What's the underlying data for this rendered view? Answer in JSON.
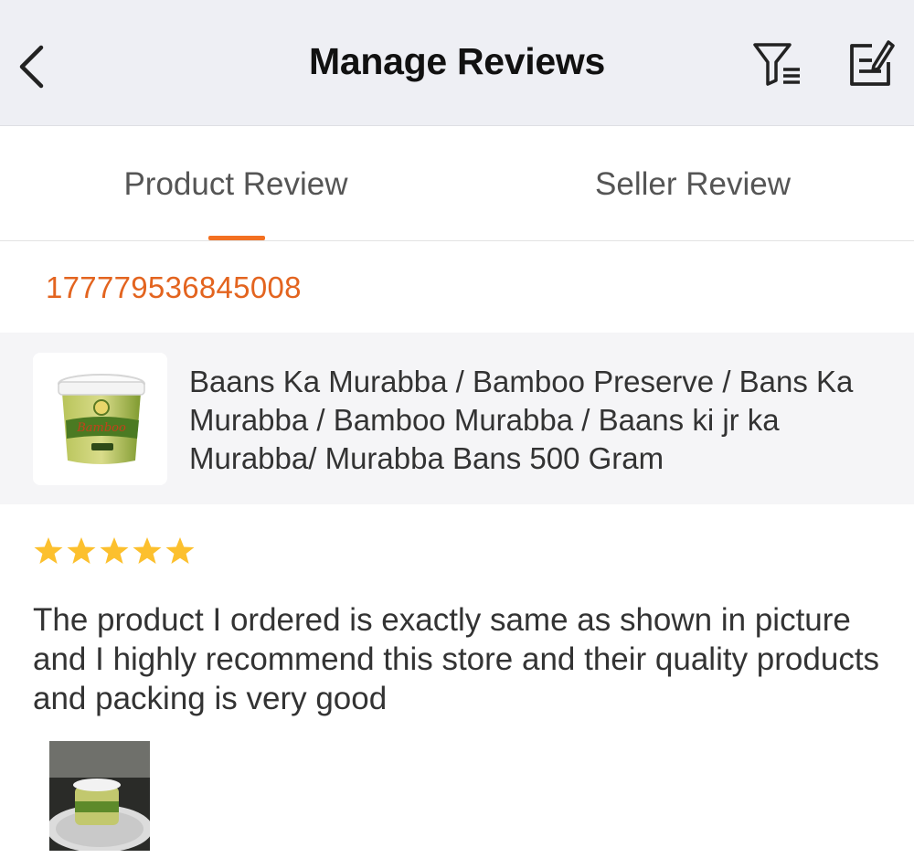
{
  "header": {
    "title": "Manage Reviews",
    "back_icon": "chevron-left-icon",
    "filter_icon": "filter-list-icon",
    "edit_icon": "write-review-icon"
  },
  "tabs": [
    {
      "label": "Product Review",
      "active": true
    },
    {
      "label": "Seller Review",
      "active": false
    }
  ],
  "order": {
    "id": "177779536845008"
  },
  "product": {
    "title": "Baans Ka Murabba / Bamboo Preserve / Bans Ka Murabba / Bamboo Murabba / Baans ki jr ka Murabba/ Murabba Bans 500 Gram",
    "thumb_label": "Bamboo"
  },
  "review": {
    "rating": 5,
    "max_rating": 5,
    "text": "The product I ordered is exactly same as shown in picture and I highly recommend this store and their quality products and packing is very good"
  },
  "colors": {
    "accent": "#f37021",
    "order_id": "#e3641f",
    "star": "#fcc02e",
    "header_bg": "#eeeff4"
  }
}
